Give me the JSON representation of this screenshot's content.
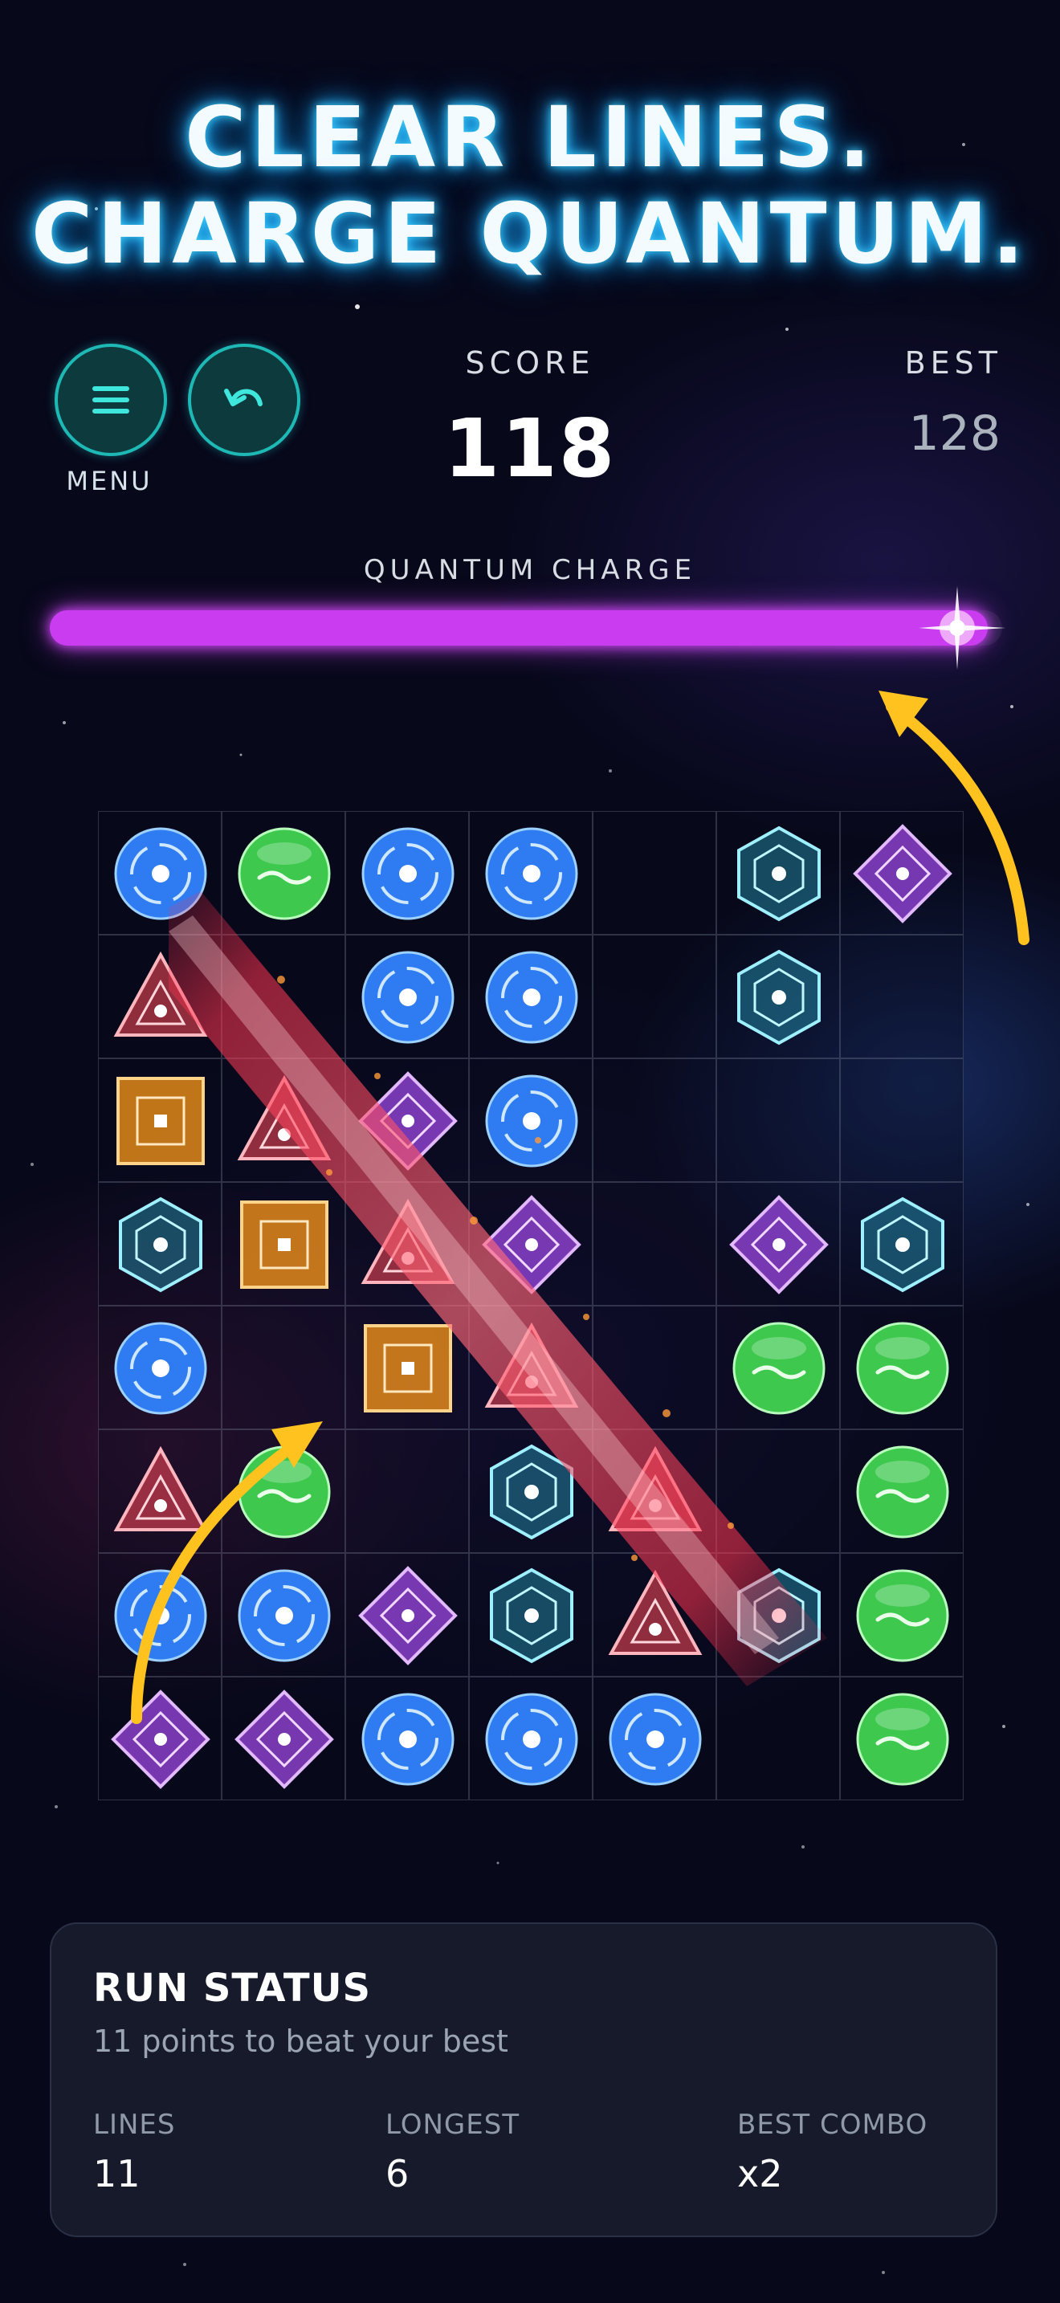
{
  "headline": {
    "line1": "CLEAR LINES.",
    "line2": "CHARGE QUANTUM."
  },
  "controls": {
    "menu_icon": "hamburger-icon",
    "undo_icon": "undo-icon",
    "menu_label": "MENU"
  },
  "score": {
    "label": "SCORE",
    "value": "118"
  },
  "best": {
    "label": "BEST",
    "value": "128"
  },
  "quantum_charge": {
    "label": "QUANTUM CHARGE",
    "fill_fraction": 0.985,
    "color": "#c93cf0"
  },
  "board": {
    "rows": [
      [
        "blue",
        "green",
        "blue",
        "blue",
        "",
        "cyan",
        "purple"
      ],
      [
        "red",
        "",
        "blue",
        "blue",
        "",
        "cyan",
        ""
      ],
      [
        "orange",
        "red",
        "purple",
        "blue",
        "",
        "",
        ""
      ],
      [
        "cyan",
        "orange",
        "red",
        "purple",
        "",
        "purple",
        "cyan"
      ],
      [
        "blue",
        "",
        "orange",
        "red",
        "",
        "green",
        "green"
      ],
      [
        "red",
        "green",
        "",
        "cyan",
        "red",
        "",
        "green"
      ],
      [
        "blue",
        "blue",
        "purple",
        "cyan",
        "red",
        "cyan",
        "green"
      ],
      [
        "purple",
        "purple",
        "blue",
        "blue",
        "blue",
        "",
        "green"
      ]
    ],
    "gem_colors": {
      "blue": "#2f7cf2",
      "green": "#3ec84e",
      "cyan": "#31c6e6",
      "purple": "#a54cf0",
      "red": "#ff4a5a",
      "orange": "#ff9a1a"
    }
  },
  "run_status": {
    "title": "RUN STATUS",
    "subtitle": "11 points to beat your best",
    "lines_label": "LINES",
    "lines_value": "11",
    "longest_label": "LONGEST",
    "longest_value": "6",
    "combo_label": "BEST COMBO",
    "combo_value": "x2"
  }
}
